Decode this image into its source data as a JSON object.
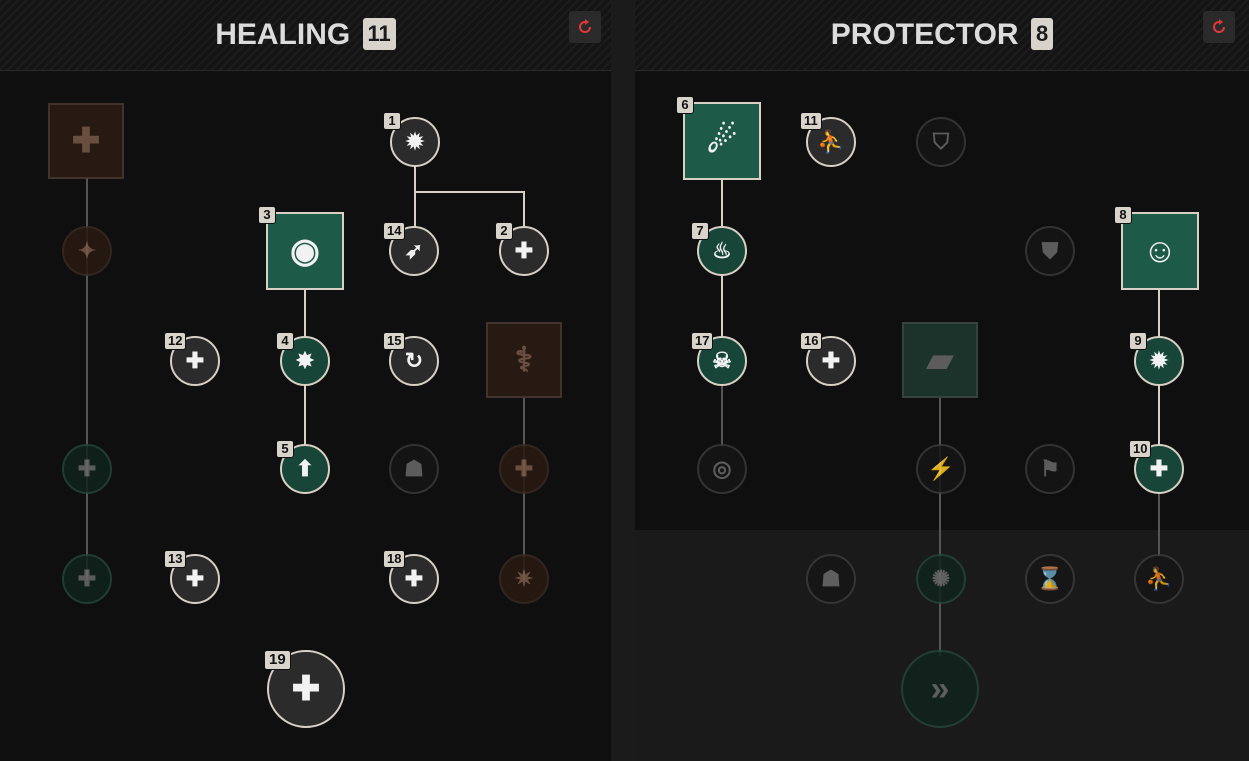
{
  "panels": [
    {
      "title": "HEALING",
      "points": "11"
    },
    {
      "title": "PROTECTOR",
      "points": "8"
    }
  ],
  "nodes": {
    "h_top": {
      "icon": "medic-cross-icon"
    },
    "h_dim1": {
      "icon": "spark-icon"
    },
    "h_dim2": {
      "icon": "cross-group-icon"
    },
    "h_dim3": {
      "icon": "cross-icon"
    },
    "h1": {
      "order": "1",
      "icon": "healing-boost-icon"
    },
    "h2": {
      "order": "2",
      "icon": "plus-icon"
    },
    "h3": {
      "order": "3",
      "icon": "orb-icon"
    },
    "h4": {
      "order": "4",
      "icon": "burst-icon"
    },
    "h5": {
      "order": "5",
      "icon": "arrow-up-icon"
    },
    "h12": {
      "order": "12",
      "icon": "cross-shield-icon"
    },
    "h13": {
      "order": "13",
      "icon": "group-heal-icon"
    },
    "h14": {
      "order": "14",
      "icon": "dash-arrow-icon"
    },
    "h15": {
      "order": "15",
      "icon": "cycle-icon"
    },
    "h18": {
      "order": "18",
      "icon": "bandage-icon"
    },
    "h19": {
      "order": "19",
      "icon": "big-cross-icon"
    },
    "h_sq2": {
      "icon": "team-heal-icon"
    },
    "h_dim4": {
      "icon": "group-icon"
    },
    "h_dim5": {
      "icon": "double-plus-icon"
    },
    "h_dim6": {
      "icon": "star-icon"
    },
    "p6": {
      "order": "6",
      "icon": "comet-icon"
    },
    "p7": {
      "order": "7",
      "icon": "flame-icon"
    },
    "p8": {
      "order": "8",
      "icon": "person-aura-icon"
    },
    "p9": {
      "order": "9",
      "icon": "up-arrow-icon"
    },
    "p10": {
      "order": "10",
      "icon": "shield-cross-icon"
    },
    "p11": {
      "order": "11",
      "icon": "runner-icon"
    },
    "p16": {
      "order": "16",
      "icon": "triple-plus-icon"
    },
    "p17": {
      "order": "17",
      "icon": "skull-icon"
    },
    "p_dim1": {
      "icon": "badge-icon"
    },
    "p_dim2": {
      "icon": "armor-icon"
    },
    "p_dim3": {
      "icon": "ring-icon"
    },
    "p_sq": {
      "icon": "canister-icon"
    },
    "p_dim4": {
      "icon": "lightning-icon"
    },
    "p_dim5": {
      "icon": "sprint-icon"
    },
    "p_dim6": {
      "icon": "group-icon"
    },
    "p_dim7": {
      "icon": "explosion-icon"
    },
    "p_dim8": {
      "icon": "hourglass-icon"
    },
    "p_dim9": {
      "icon": "runner-icon"
    },
    "p_big": {
      "icon": "shield-dash-icon"
    }
  }
}
